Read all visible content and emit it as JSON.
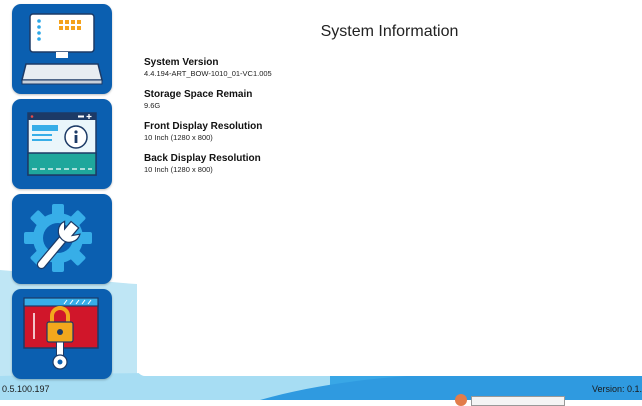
{
  "sidebar": {
    "items": [
      {
        "name": "system-console"
      },
      {
        "name": "system-information",
        "active": true
      },
      {
        "name": "settings"
      },
      {
        "name": "security-lock"
      }
    ]
  },
  "panel": {
    "title": "System Information",
    "items": [
      {
        "label": "System Version",
        "value": "4.4.194-ART_BOW-1010_01-VC1.005"
      },
      {
        "label": "Storage Space Remain",
        "value": "9.6G"
      },
      {
        "label": "Front Display Resolution",
        "value": "10 Inch (1280 x 800)"
      },
      {
        "label": "Back Display Resolution",
        "value": "10 Inch (1280 x 800)"
      }
    ]
  },
  "footer": {
    "ip": "0.5.100.197",
    "version": "Version: 0.1."
  },
  "colors": {
    "tile": "#0b5fb0",
    "accent_light_blue": "#40b4f0",
    "lock_red": "#d0162a",
    "lock_gold": "#f2a81d"
  }
}
